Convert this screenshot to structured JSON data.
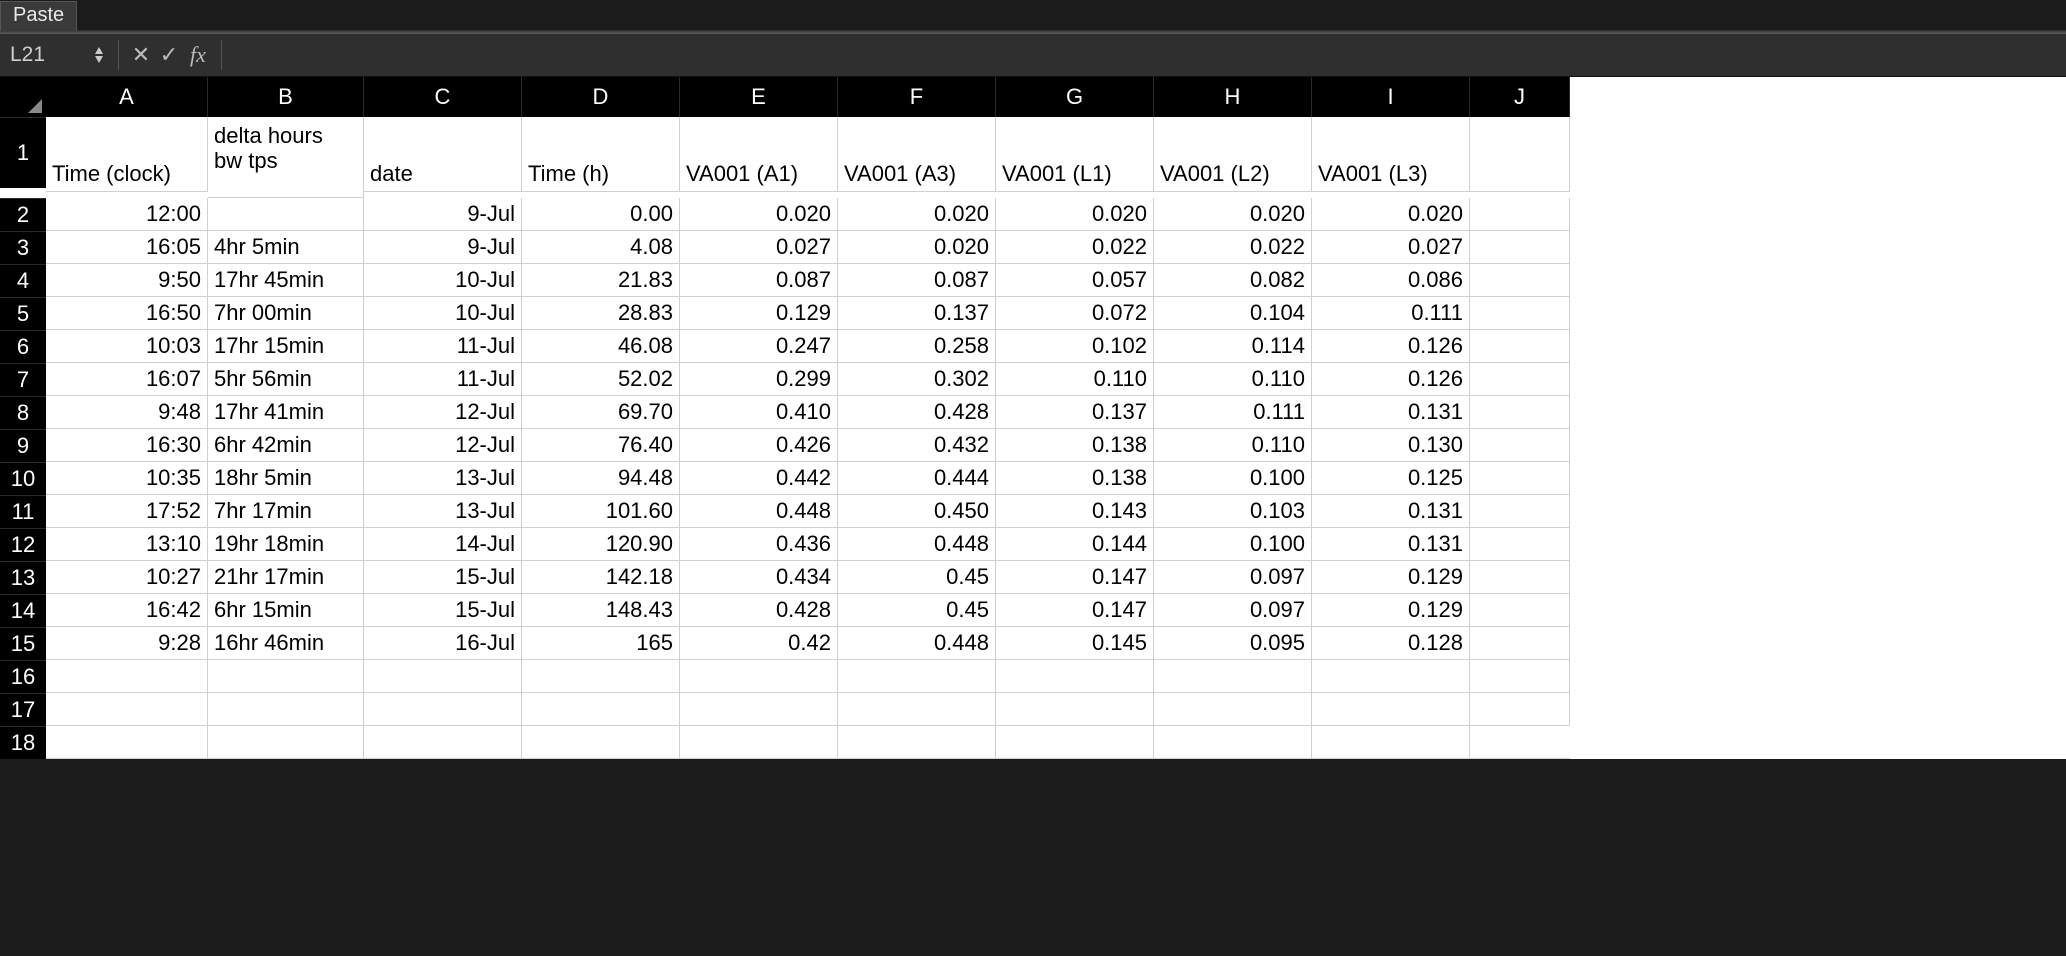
{
  "ribbon": {
    "paste_tab": "Paste"
  },
  "formula_bar": {
    "name_box": "L21",
    "cancel_glyph": "✕",
    "accept_glyph": "✓",
    "fx_label": "fx",
    "formula_value": ""
  },
  "columns": [
    "A",
    "B",
    "C",
    "D",
    "E",
    "F",
    "G",
    "H",
    "I",
    "J"
  ],
  "row_numbers": [
    "1",
    "2",
    "3",
    "4",
    "5",
    "6",
    "7",
    "8",
    "9",
    "10",
    "11",
    "12",
    "13",
    "14",
    "15",
    "16",
    "17",
    "18"
  ],
  "headers": {
    "A": "Time (clock)",
    "B": "delta hours bw tps",
    "C": "date",
    "D": "Time (h)",
    "E": "VA001 (A1)",
    "F": "VA001 (A3)",
    "G": "VA001 (L1)",
    "H": "VA001 (L2)",
    "I": "VA001 (L3)",
    "J": ""
  },
  "data_rows": [
    {
      "A": "12:00",
      "B": "",
      "C": "9-Jul",
      "D": "0.00",
      "E": "0.020",
      "F": "0.020",
      "G": "0.020",
      "H": "0.020",
      "I": "0.020"
    },
    {
      "A": "16:05",
      "B": "4hr 5min",
      "C": "9-Jul",
      "D": "4.08",
      "E": "0.027",
      "F": "0.020",
      "G": "0.022",
      "H": "0.022",
      "I": "0.027"
    },
    {
      "A": "9:50",
      "B": "17hr 45min",
      "C": "10-Jul",
      "D": "21.83",
      "E": "0.087",
      "F": "0.087",
      "G": "0.057",
      "H": "0.082",
      "I": "0.086"
    },
    {
      "A": "16:50",
      "B": "7hr 00min",
      "C": "10-Jul",
      "D": "28.83",
      "E": "0.129",
      "F": "0.137",
      "G": "0.072",
      "H": "0.104",
      "I": "0.111"
    },
    {
      "A": "10:03",
      "B": "17hr 15min",
      "C": "11-Jul",
      "D": "46.08",
      "E": "0.247",
      "F": "0.258",
      "G": "0.102",
      "H": "0.114",
      "I": "0.126"
    },
    {
      "A": "16:07",
      "B": "5hr 56min",
      "C": "11-Jul",
      "D": "52.02",
      "E": "0.299",
      "F": "0.302",
      "G": "0.110",
      "H": "0.110",
      "I": "0.126"
    },
    {
      "A": "9:48",
      "B": "17hr 41min",
      "C": "12-Jul",
      "D": "69.70",
      "E": "0.410",
      "F": "0.428",
      "G": "0.137",
      "H": "0.111",
      "I": "0.131"
    },
    {
      "A": "16:30",
      "B": "6hr 42min",
      "C": "12-Jul",
      "D": "76.40",
      "E": "0.426",
      "F": "0.432",
      "G": "0.138",
      "H": "0.110",
      "I": "0.130"
    },
    {
      "A": "10:35",
      "B": "18hr 5min",
      "C": "13-Jul",
      "D": "94.48",
      "E": "0.442",
      "F": "0.444",
      "G": "0.138",
      "H": "0.100",
      "I": "0.125"
    },
    {
      "A": "17:52",
      "B": "7hr 17min",
      "C": "13-Jul",
      "D": "101.60",
      "E": "0.448",
      "F": "0.450",
      "G": "0.143",
      "H": "0.103",
      "I": "0.131"
    },
    {
      "A": "13:10",
      "B": "19hr 18min",
      "C": "14-Jul",
      "D": "120.90",
      "E": "0.436",
      "F": "0.448",
      "G": "0.144",
      "H": "0.100",
      "I": "0.131"
    },
    {
      "A": "10:27",
      "B": "21hr 17min",
      "C": "15-Jul",
      "D": "142.18",
      "E": "0.434",
      "F": "0.45",
      "G": "0.147",
      "H": "0.097",
      "I": "0.129"
    },
    {
      "A": "16:42",
      "B": "6hr 15min",
      "C": "15-Jul",
      "D": "148.43",
      "E": "0.428",
      "F": "0.45",
      "G": "0.147",
      "H": "0.097",
      "I": "0.129"
    },
    {
      "A": "9:28",
      "B": "16hr 46min",
      "C": "16-Jul",
      "D": "165",
      "E": "0.42",
      "F": "0.448",
      "G": "0.145",
      "H": "0.095",
      "I": "0.128"
    }
  ],
  "empty_rows": 3,
  "right_align_cols": [
    "A",
    "C",
    "D",
    "E",
    "F",
    "G",
    "H",
    "I"
  ],
  "left_align_cols": [
    "B"
  ]
}
